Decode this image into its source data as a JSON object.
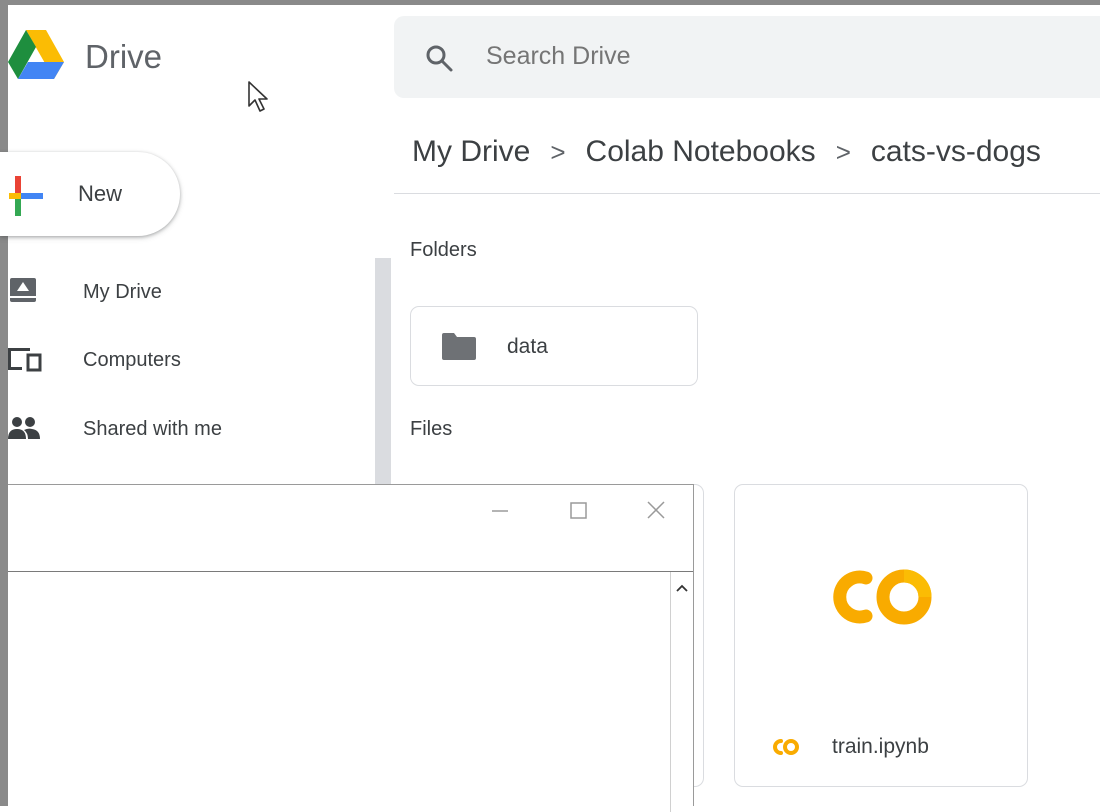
{
  "app": {
    "name": "Drive"
  },
  "search": {
    "placeholder": "Search Drive"
  },
  "breadcrumb": {
    "items": [
      "My Drive",
      "Colab Notebooks",
      "cats-vs-dogs"
    ],
    "separator": ">"
  },
  "new_button": {
    "label": "New"
  },
  "nav": {
    "items": [
      {
        "label": "My Drive",
        "icon": "my-drive-icon"
      },
      {
        "label": "Computers",
        "icon": "computers-icon"
      },
      {
        "label": "Shared with me",
        "icon": "shared-icon"
      }
    ]
  },
  "main": {
    "folders_label": "Folders",
    "files_label": "Files",
    "folders": [
      {
        "name": "data",
        "icon": "folder-icon"
      }
    ],
    "files": [
      {
        "name": "train.ipynb",
        "icon": "colab-icon"
      }
    ]
  },
  "colors": {
    "brand_yellow": "#f9ab00",
    "google_blue": "#4285f4",
    "google_red": "#ea4335",
    "google_green": "#34a853",
    "google_yellow": "#fbbc04"
  }
}
